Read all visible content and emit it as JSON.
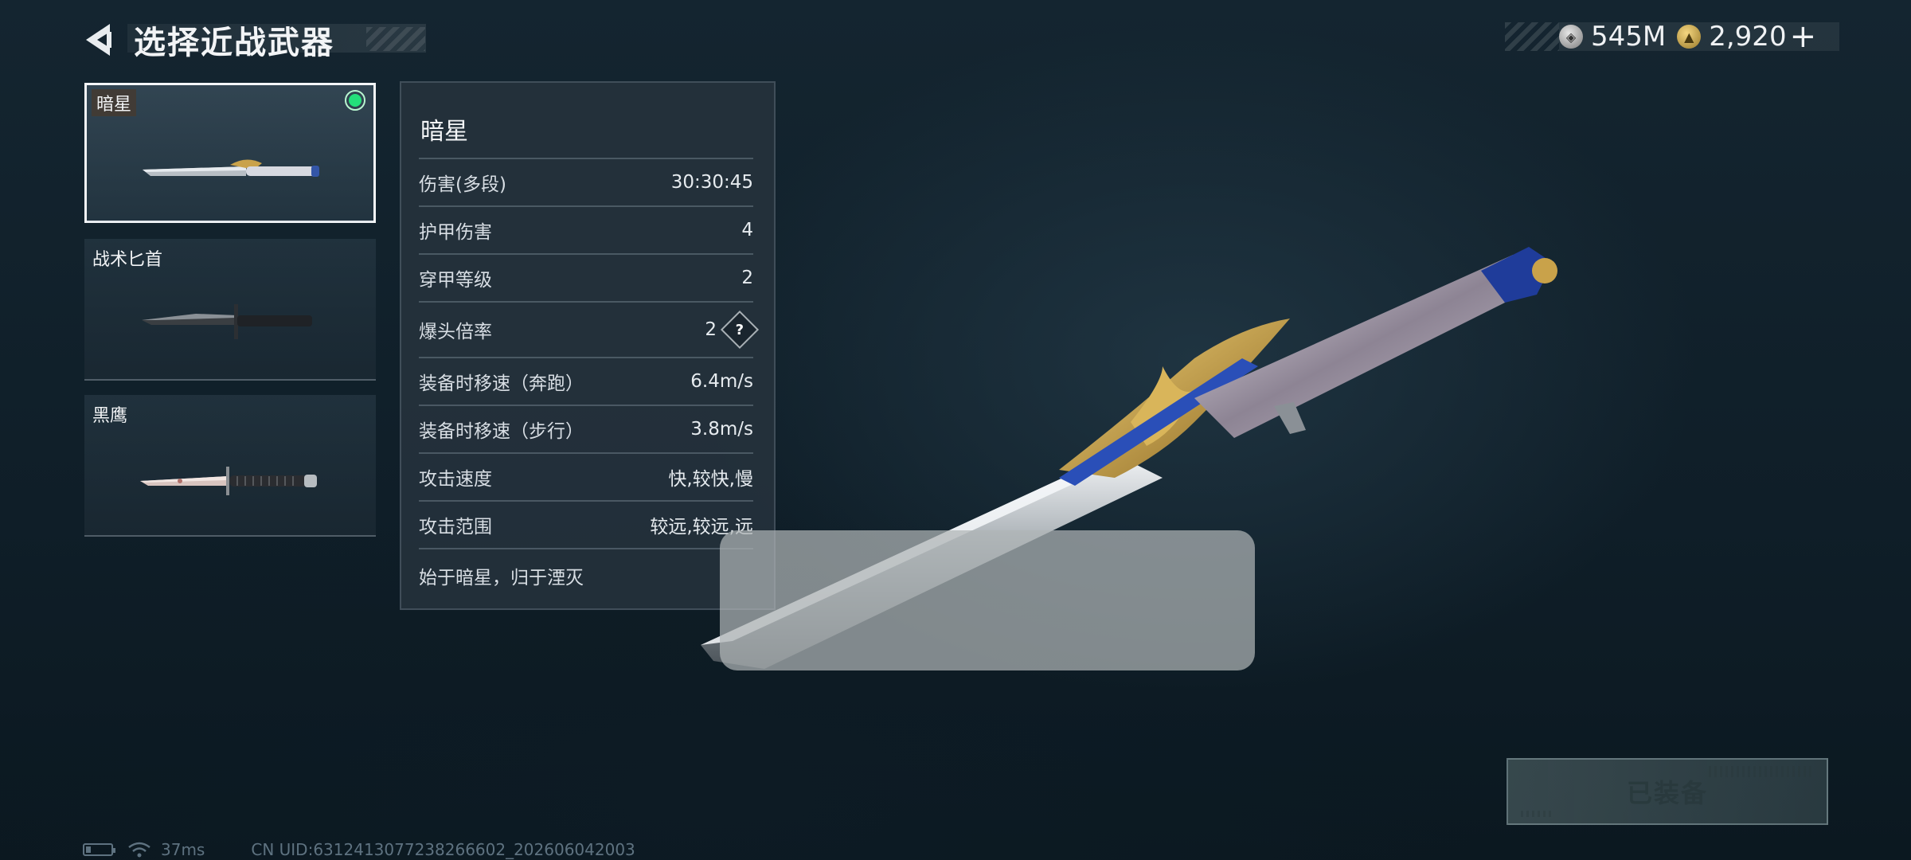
{
  "header": {
    "title": "选择近战武器",
    "back_icon": "back-arrow-icon"
  },
  "currency": {
    "silver_icon": "silver-coin-icon",
    "silver_value": "545M",
    "gold_icon": "gold-coin-icon",
    "gold_value": "2,920",
    "plus_label": "+"
  },
  "weapons": [
    {
      "name": "暗星",
      "selected": true,
      "equipped": true
    },
    {
      "name": "战术匕首",
      "selected": false,
      "equipped": false
    },
    {
      "name": "黑鹰",
      "selected": false,
      "equipped": false
    }
  ],
  "stats": {
    "title": "暗星",
    "rows": [
      {
        "label": "伤害(多段)",
        "value": "30:30:45"
      },
      {
        "label": "护甲伤害",
        "value": "4"
      },
      {
        "label": "穿甲等级",
        "value": "2"
      },
      {
        "label": "爆头倍率",
        "value": "2",
        "help_label": "?"
      },
      {
        "label": "装备时移速（奔跑）",
        "value": "6.4m/s"
      },
      {
        "label": "装备时移速（步行）",
        "value": "3.8m/s"
      },
      {
        "label": "攻击速度",
        "value": "快,较快,慢"
      },
      {
        "label": "攻击范围",
        "value": "较远,较远,远"
      }
    ],
    "description": "始于暗星，归于湮灭"
  },
  "equip_button": {
    "label": "已装备"
  },
  "footer": {
    "ping": "37ms",
    "uid": "CN UID:6312413077238266602_202606042003"
  },
  "colors": {
    "accent_green": "#23e07a",
    "panel_bg": "#26323c",
    "gold": "#c9a24a",
    "blue_gem": "#2a4fb8"
  }
}
